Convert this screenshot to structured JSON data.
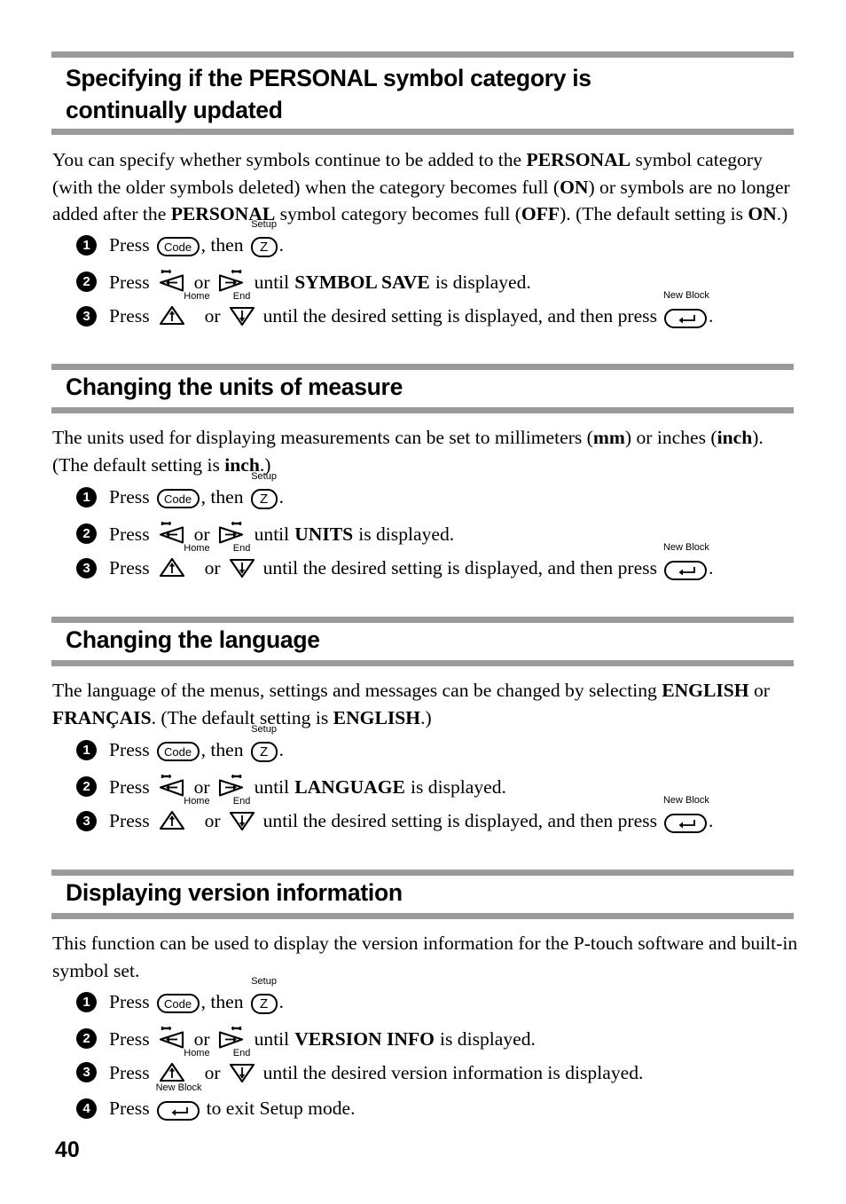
{
  "page": {
    "number": "40",
    "rule_color": "#9a9a9a"
  },
  "sections": [
    {
      "heading": "Specifying if the PERSONAL symbol category is continually updated",
      "heading_line1": "Specifying if the PERSONAL symbol category is",
      "heading_line2": "continually updated",
      "body": "You can specify whether symbols continue to be added to the PERSONAL symbol category (with the older symbols deleted) when the category becomes full (ON) or symbols are no longer added after the PERSONAL symbol category becomes full (OFF). (The default setting is ON.)",
      "body_parts": {
        "p1": "You can specify whether symbols continue to be added to the ",
        "b1": "PERSONAL",
        "p2": " symbol category (with the older symbols deleted) when the category becomes full (",
        "b2": "ON",
        "p3": ") or symbols are no longer added after the ",
        "b3": "PERSONAL",
        "p4": " symbol category becomes full (",
        "b4": "OFF",
        "p5": "). (The default setting is ",
        "b5": "ON",
        "p6": ".)"
      },
      "steps": [
        {
          "num": "1",
          "press": "Press",
          "keys": [
            "Code",
            "Z"
          ],
          "key_labels": [
            "",
            "Setup"
          ],
          "after_first": ", then",
          "tail": "."
        },
        {
          "num": "2",
          "press": "Press",
          "or": "or",
          "until": "until",
          "target": "SYMBOL SAVE",
          "tail": "is displayed."
        },
        {
          "num": "3",
          "press": "Press",
          "up_label": "Home",
          "down_label": "End",
          "or": "or",
          "mid": "until the desired setting is displayed, and then press",
          "enter_label": "New Block",
          "tail": "."
        }
      ]
    },
    {
      "heading": "Changing the units of measure",
      "body": "The units used for displaying measurements can be set to millimeters (mm) or inches (inch). (The default setting is inch.)",
      "body_parts": {
        "p1": "The units used for displaying measurements can be set to millimeters (",
        "b1": "mm",
        "p2": ") or inches (",
        "b2": "inch",
        "p3": "). (The default setting is ",
        "b3": "inch",
        "p4": ".)"
      },
      "steps": [
        {
          "num": "1",
          "press": "Press",
          "after_first": ", then",
          "tail": "."
        },
        {
          "num": "2",
          "press": "Press",
          "or": "or",
          "until": "until",
          "target": "UNITS",
          "tail": "is displayed."
        },
        {
          "num": "3",
          "press": "Press",
          "or": "or",
          "mid": "until the desired setting is displayed, and then press",
          "tail": "."
        }
      ]
    },
    {
      "heading": "Changing the language",
      "body": "The language of the menus, settings and messages can be changed by selecting ENGLISH or FRANÇAIS. (The default setting is ENGLISH.)",
      "body_parts": {
        "p1": "The language of the menus, settings and messages can be changed by selecting ",
        "b1": "ENGLISH",
        "p2": " or ",
        "b2": "FRANÇAIS",
        "p3": ". (The default setting is ",
        "b3": "ENGLISH",
        "p4": ".)"
      },
      "steps": [
        {
          "num": "1",
          "press": "Press",
          "after_first": ", then",
          "tail": "."
        },
        {
          "num": "2",
          "press": "Press",
          "or": "or",
          "until": "until",
          "target": "LANGUAGE",
          "tail": "is displayed."
        },
        {
          "num": "3",
          "press": "Press",
          "or": "or",
          "mid": "until the desired setting is displayed, and then press",
          "tail": "."
        }
      ]
    },
    {
      "heading": "Displaying version information",
      "body": "This function can be used to display the version information for the P-touch software and built-in symbol set.",
      "body_parts": {
        "p1": "This function can be used to display the version information for the P-touch software and built-in symbol set."
      },
      "steps": [
        {
          "num": "1",
          "press": "Press",
          "after_first": ", then",
          "tail": "."
        },
        {
          "num": "2",
          "press": "Press",
          "or": "or",
          "until": "until",
          "target": "VERSION INFO",
          "tail": "is displayed."
        },
        {
          "num": "3",
          "press": "Press",
          "or": "or",
          "mid": "until the desired version information is displayed.",
          "tail": ""
        },
        {
          "num": "4",
          "press": "Press",
          "mid": "to exit Setup mode.",
          "tail": ""
        }
      ]
    }
  ],
  "keys": {
    "code_label": "Code",
    "z_label": "Z",
    "setup_label": "Setup",
    "home_label": "Home",
    "end_label": "End",
    "new_block_label": "New Block",
    "enter_glyph": "←"
  }
}
